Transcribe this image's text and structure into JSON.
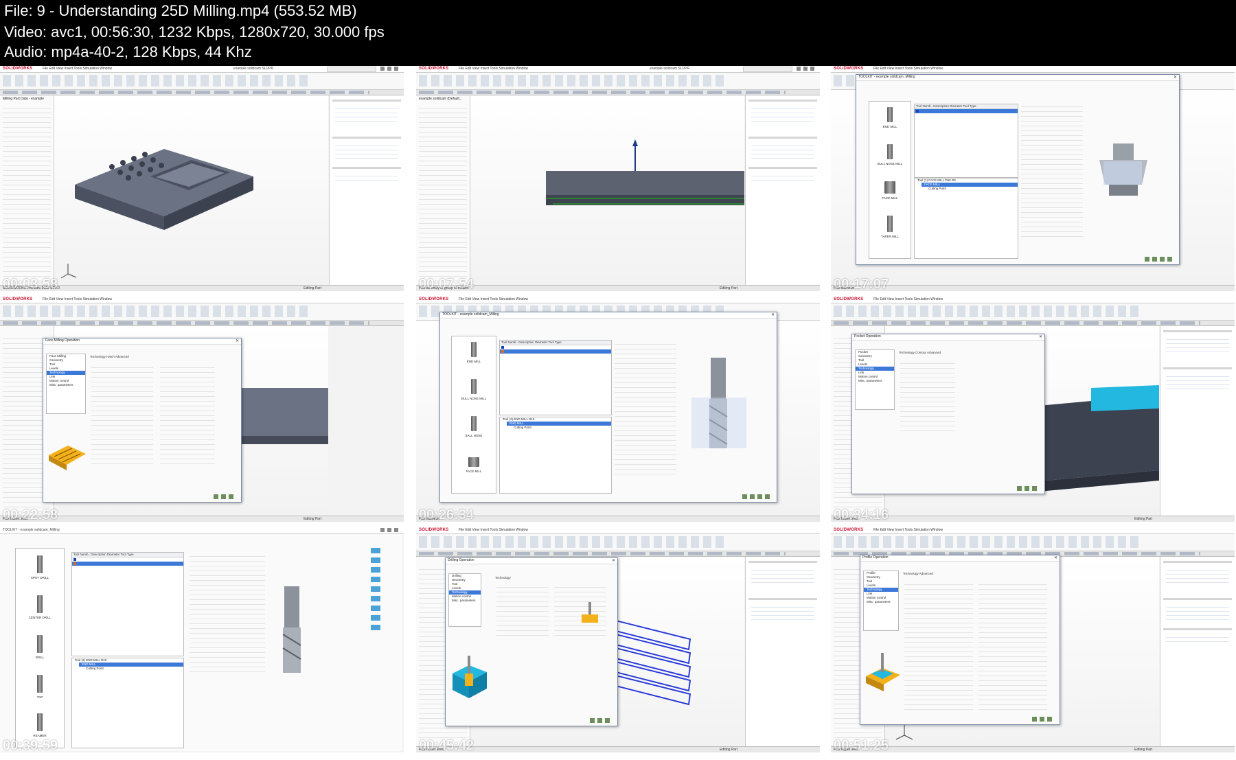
{
  "header": {
    "file": "File: 9 - Understanding 25D Milling.mp4 (553.52 MB)",
    "video": "Video: avc1, 00:56:30, 1232 Kbps, 1280x720, 30.000 fps",
    "audio": "Audio: mp4a-40-2, 128 Kbps, 44 Khz"
  },
  "app": {
    "logo": "SOLIDWORKS",
    "menus": "File  Edit  View  Insert  Tools  Simulation  Window",
    "doc_name": "example solidcam SLDPR"
  },
  "thumbnails": [
    {
      "timestamp": "00:03:58",
      "panel_title": "Milling Part Data - example",
      "status_left": "SOLIDWORKS Premium 2022 SP0.0",
      "status_right": "Editing Part",
      "task_heads": [
        "Welcome to SOLIDWORKS",
        "SOLIDWORKS Tools",
        "Online Resources",
        "Subscription Services"
      ]
    },
    {
      "timestamp": "00:07:54",
      "panel_title": "example solidcam (Default...",
      "status_left": "Pick an entity or group of entities",
      "status_right": "Editing Part",
      "task_heads": [
        "Welcome to SOLIDWORKS",
        "SOLIDWORKS Tools",
        "Online Resources",
        "Subscription Services"
      ]
    },
    {
      "timestamp": "00:17:07",
      "dialog_title": "TOOLKIT - example solidcam_Milling",
      "tools": [
        "END MILL",
        "BULL NOSE MILL",
        "FACE MILL",
        "TAPER MILL"
      ],
      "table_header": [
        "Tool Numb..",
        "Description",
        "Diameter",
        "Tool Type",
        "Tool ID"
      ],
      "tree_root": "Tool (1) FACE MILL D50 R0",
      "tree_sel": "FACE MILL",
      "tree_leaf": "Cutting Point",
      "status_left": "Pick diameter"
    },
    {
      "timestamp": "00:22:58",
      "dialog_title": "Face Milling Operation",
      "tech_label": "Face Milling",
      "tree_items": [
        "Geometry",
        "Tool",
        "Levels",
        "Technology",
        "Link",
        "Motion control",
        "Misc. parameters"
      ],
      "tree_sel": "Technology",
      "tabs": "Technology   Hatch   Advanced",
      "status_left": "Pick Lower level",
      "status_right": "Editing Part"
    },
    {
      "timestamp": "00:26:34",
      "dialog_title": "TOOLKIT - example solidcam_Milling",
      "tools": [
        "END MILL",
        "BULL NOSE MILL",
        "BALL NOSE",
        "FACE MILL"
      ],
      "table_header": [
        "Tool Numb..",
        "Description",
        "Diameter",
        "Tool Type",
        "Tool ID"
      ],
      "tree_root": "Tool (2) END MILL D10",
      "tree_sel": "END MILL",
      "tree_leaf": "Cutting Point",
      "status_left": "Pick diameter"
    },
    {
      "timestamp": "00:34:16",
      "dialog_title": "Pocket Operation",
      "tech_label": "Pocket",
      "tree_items": [
        "Geometry",
        "Tool",
        "Levels",
        "Technology",
        "Link",
        "Motion control",
        "Misc. parameters"
      ],
      "tree_sel": "Technology",
      "tabs": "Technology   Contour   Advanced",
      "status_left": "Pick Lower level",
      "status_right": "Editing Part"
    },
    {
      "timestamp": "00:39:59",
      "dialog_title": "TOOLKIT - example solidcam_Milling",
      "tools": [
        "SPOT DRILL",
        "CENTER DRILL",
        "DRILL",
        "TAP",
        "REAMER"
      ],
      "table_header": [
        "Tool Numb..",
        "Description",
        "Diameter",
        "Tool Type",
        "Tool ID"
      ],
      "tree_root": "Tool (2) END MILL D10",
      "tree_sel": "END MILL",
      "tree_leaf": "Cutting Point",
      "status_left": "Pick diameter"
    },
    {
      "timestamp": "00:45:42",
      "dialog_title": "Drilling Operation",
      "tech_label": "Drilling",
      "tree_items": [
        "Geometry",
        "Tool",
        "Levels",
        "Technology",
        "Motion control",
        "Misc. parameters"
      ],
      "tree_sel": "Technology",
      "tabs": "Technology",
      "status_left": "Pick Lower level",
      "status_right": "Editing Part"
    },
    {
      "timestamp": "00:51:25",
      "dialog_title": "Profile Operation",
      "tech_label": "Profile",
      "tree_items": [
        "Geometry",
        "Tool",
        "Levels",
        "Technology",
        "Link",
        "Motion control",
        "Misc. parameters"
      ],
      "tree_sel": "Technology",
      "tabs": "Technology   Advanced",
      "status_left": "Pick Upper level",
      "status_right": "Editing Part"
    }
  ]
}
